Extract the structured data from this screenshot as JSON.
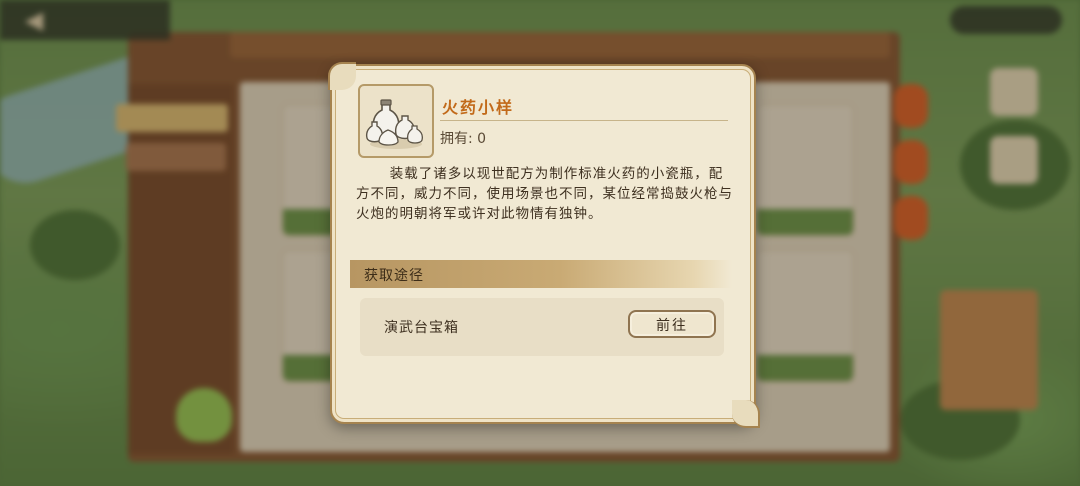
{
  "item": {
    "name": "火药小样",
    "owned_label": "拥有:",
    "owned_count": "0",
    "icon": "porcelain-bottles-icon",
    "description": "装载了诸多以现世配方为制作标准火药的小瓷瓶，配方不同，威力不同，使用场景也不同，某位经常捣鼓火枪与火炮的明朝将军或许对此物情有独钟。"
  },
  "acquisition": {
    "header": "获取途径",
    "sources": [
      {
        "name": "演武台宝箱",
        "button_label": "前往"
      }
    ]
  },
  "colors": {
    "title": "#c26a1a",
    "panel": "#f1e9d3",
    "frame": "#a5834f"
  }
}
